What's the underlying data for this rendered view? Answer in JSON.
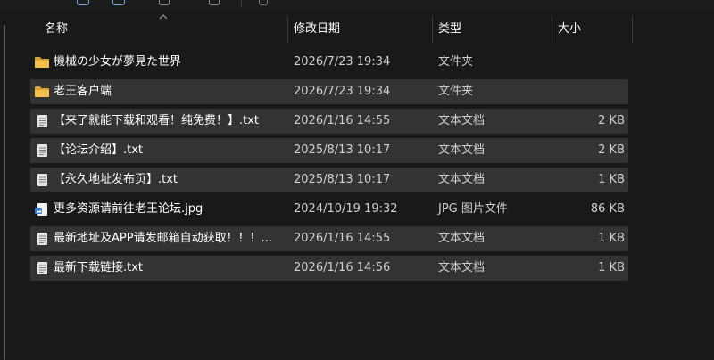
{
  "header": {
    "columns": [
      {
        "label": "名称"
      },
      {
        "label": "修改日期"
      },
      {
        "label": "类型"
      },
      {
        "label": "大小"
      }
    ],
    "sort_column": "名称",
    "sort_direction": "ascending"
  },
  "files": [
    {
      "name": "機械の少女が夢見た世界",
      "date": "2026/7/23 19:34",
      "type": "文件夹",
      "size": "",
      "icon": "folder-icon",
      "selected": false
    },
    {
      "name": "老王客户端",
      "date": "2026/7/23 19:34",
      "type": "文件夹",
      "size": "",
      "icon": "folder-icon",
      "selected": true
    },
    {
      "name": "【来了就能下载和观看！纯免费！】.txt",
      "date": "2026/1/16 14:55",
      "type": "文本文档",
      "size": "2 KB",
      "icon": "text-file-icon",
      "selected": true
    },
    {
      "name": "【论坛介绍】.txt",
      "date": "2025/8/13 10:17",
      "type": "文本文档",
      "size": "2 KB",
      "icon": "text-file-icon",
      "selected": true
    },
    {
      "name": "【永久地址发布页】.txt",
      "date": "2025/8/13 10:17",
      "type": "文本文档",
      "size": "1 KB",
      "icon": "text-file-icon",
      "selected": true
    },
    {
      "name": "更多资源请前往老王论坛.jpg",
      "date": "2024/10/19 19:32",
      "type": "JPG 图片文件",
      "size": "86 KB",
      "icon": "image-file-icon",
      "selected": false
    },
    {
      "name": "最新地址及APP请发邮箱自动获取！！！...",
      "date": "2026/1/16 14:55",
      "type": "文本文档",
      "size": "1 KB",
      "icon": "text-file-icon",
      "selected": true
    },
    {
      "name": "最新下载链接.txt",
      "date": "2026/1/16 14:56",
      "type": "文本文档",
      "size": "1 KB",
      "icon": "text-file-icon",
      "selected": true
    }
  ],
  "colors": {
    "background": "#191919",
    "selection": "#333333",
    "folder": "#f4c04a",
    "text": "#ffffff",
    "secondary_text": "#d0d0d0"
  }
}
